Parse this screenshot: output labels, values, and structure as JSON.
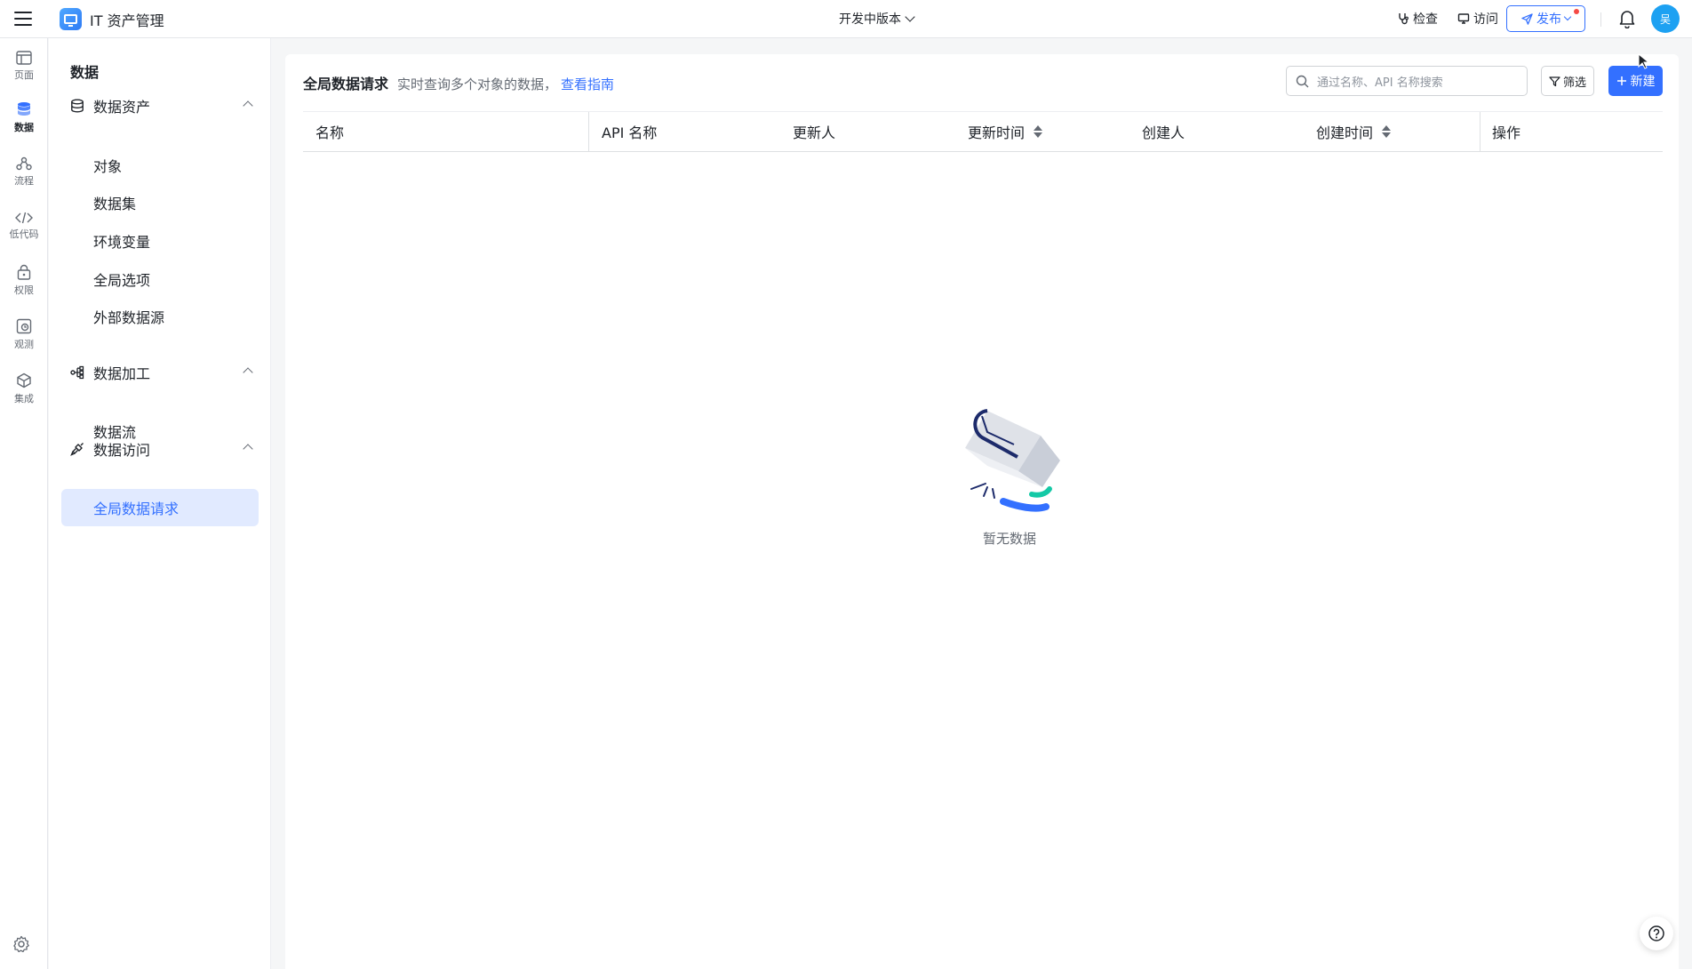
{
  "header": {
    "app_title": "IT 资产管理",
    "version_label": "开发中版本",
    "check_label": "检查",
    "visit_label": "访问",
    "publish_label": "发布",
    "avatar_text": "吴"
  },
  "rail": {
    "items": [
      {
        "label": "页面",
        "icon": "page-icon"
      },
      {
        "label": "数据",
        "icon": "database-icon"
      },
      {
        "label": "流程",
        "icon": "flow-icon"
      },
      {
        "label": "低代码",
        "icon": "code-icon"
      },
      {
        "label": "权限",
        "icon": "lock-icon"
      },
      {
        "label": "观测",
        "icon": "monitor-icon"
      },
      {
        "label": "集成",
        "icon": "cube-icon"
      }
    ]
  },
  "sidebar": {
    "title": "数据",
    "groups": [
      {
        "label": "数据资产",
        "items": [
          "对象",
          "数据集",
          "环境变量",
          "全局选项",
          "外部数据源"
        ]
      },
      {
        "label": "数据加工",
        "items": [
          "数据流"
        ]
      },
      {
        "label": "数据访问",
        "items": [
          "全局数据请求"
        ]
      }
    ]
  },
  "main": {
    "title": "全局数据请求",
    "description": "实时查询多个对象的数据，",
    "guide_link": "查看指南",
    "search_placeholder": "通过名称、API 名称搜索",
    "filter_label": "筛选",
    "new_label": "新建",
    "columns": [
      "名称",
      "API 名称",
      "更新人",
      "更新时间",
      "创建人",
      "创建时间",
      "操作"
    ],
    "empty_text": "暂无数据"
  },
  "colors": {
    "accent": "#3370ff",
    "active_bg": "#e1eaff",
    "avatar": "#1da1f2",
    "notification_dot": "#f54a45"
  }
}
